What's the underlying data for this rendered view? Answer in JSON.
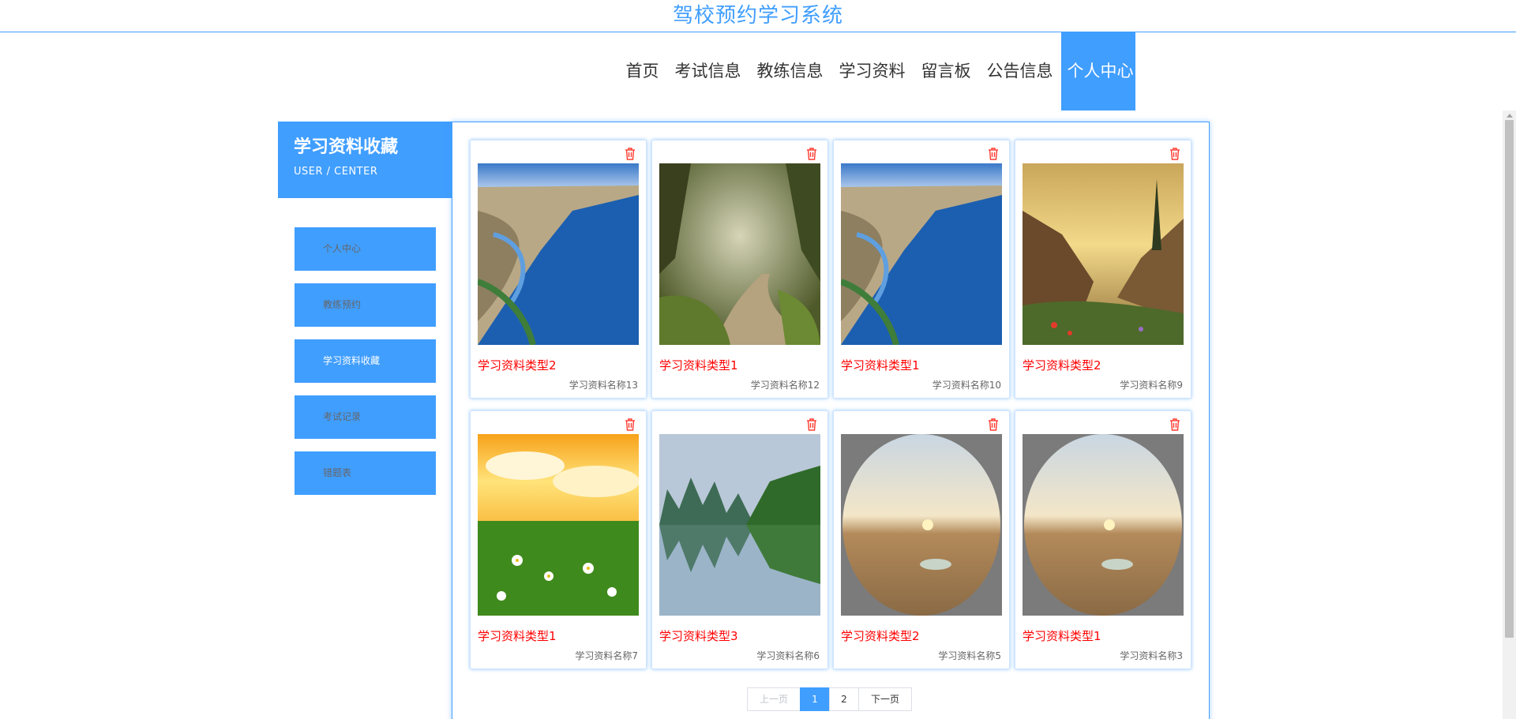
{
  "site": {
    "title": "驾校预约学习系统"
  },
  "nav": [
    {
      "label": "首页"
    },
    {
      "label": "考试信息"
    },
    {
      "label": "教练信息"
    },
    {
      "label": "学习资料"
    },
    {
      "label": "留言板"
    },
    {
      "label": "公告信息"
    },
    {
      "label": "个人中心",
      "active": true
    }
  ],
  "sidebar": {
    "title": "学习资料收藏",
    "subtitle": "USER / CENTER",
    "items": [
      {
        "label": "个人中心"
      },
      {
        "label": "教练预约"
      },
      {
        "label": "学习资料收藏",
        "active": true
      },
      {
        "label": "考试记录"
      },
      {
        "label": "错题表"
      }
    ]
  },
  "cards": [
    {
      "type": "学习资料类型2",
      "name": "学习资料名称13",
      "image": "coast",
      "icon": "trash-icon"
    },
    {
      "type": "学习资料类型1",
      "name": "学习资料名称12",
      "image": "forest-path",
      "icon": "trash-icon"
    },
    {
      "type": "学习资料类型1",
      "name": "学习资料名称10",
      "image": "coast",
      "icon": "trash-icon"
    },
    {
      "type": "学习资料类型2",
      "name": "学习资料名称9",
      "image": "mountain-valley",
      "icon": "trash-icon"
    },
    {
      "type": "学习资料类型1",
      "name": "学习资料名称7",
      "image": "daisy-sunset",
      "icon": "trash-icon"
    },
    {
      "type": "学习资料类型3",
      "name": "学习资料名称6",
      "image": "karst-reflection",
      "icon": "trash-icon"
    },
    {
      "type": "学习资料类型2",
      "name": "学习资料名称5",
      "image": "desert-circle",
      "icon": "trash-icon"
    },
    {
      "type": "学习资料类型1",
      "name": "学习资料名称3",
      "image": "desert-circle",
      "icon": "trash-icon"
    }
  ],
  "pagination": {
    "prev": "上一页",
    "current": "1",
    "page2": "2",
    "next": "下一页"
  },
  "colors": {
    "accent": "#409eff",
    "danger": "#ff0000"
  }
}
